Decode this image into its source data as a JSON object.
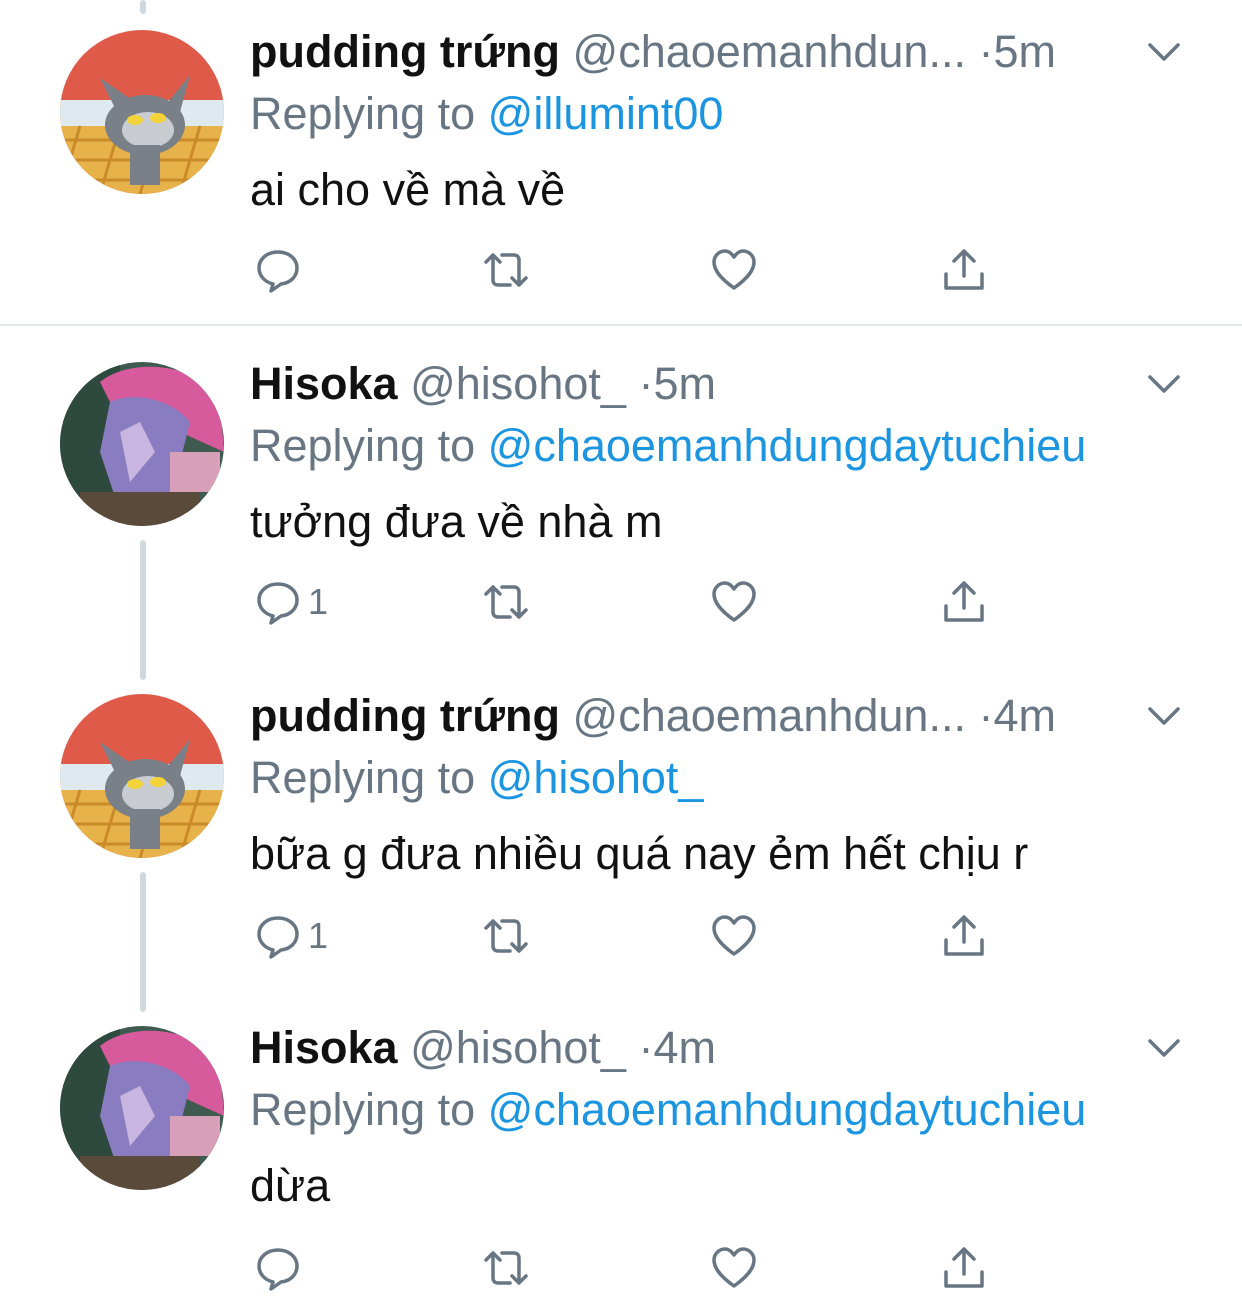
{
  "colors": {
    "name": "#111111",
    "secondary": "#687684",
    "link": "#1b95e0",
    "thread_line": "#cfd9de",
    "divider": "#e1e8ed"
  },
  "tweets": [
    {
      "name": "pudding trứng",
      "handle": "@chaoemanhdun...",
      "dot": "·",
      "time": "5m",
      "replying_prefix": "Replying to ",
      "replying_to": "@illumint00",
      "text": "ai cho về mà về",
      "reply_count": "",
      "avatar": "tom-cat-avatar"
    },
    {
      "name": "Hisoka",
      "handle": "@hisohot_",
      "dot": "·",
      "time": "5m",
      "replying_prefix": "Replying to ",
      "replying_to": "@chaoemanhdungdaytuchieu",
      "text": "tưởng đưa về nhà m",
      "reply_count": "1",
      "avatar": "hisoka-avatar"
    },
    {
      "name": "pudding trứng",
      "handle": "@chaoemanhdun...",
      "dot": "·",
      "time": "4m",
      "replying_prefix": "Replying to ",
      "replying_to": "@hisohot_",
      "text": "bữa g đưa nhiều quá nay ẻm hết chịu r",
      "reply_count": "1",
      "avatar": "tom-cat-avatar"
    },
    {
      "name": "Hisoka",
      "handle": "@hisohot_",
      "dot": "·",
      "time": "4m",
      "replying_prefix": "Replying to ",
      "replying_to": "@chaoemanhdungdaytuchieu",
      "text": "dừa",
      "reply_count": "",
      "avatar": "hisoka-avatar"
    }
  ]
}
